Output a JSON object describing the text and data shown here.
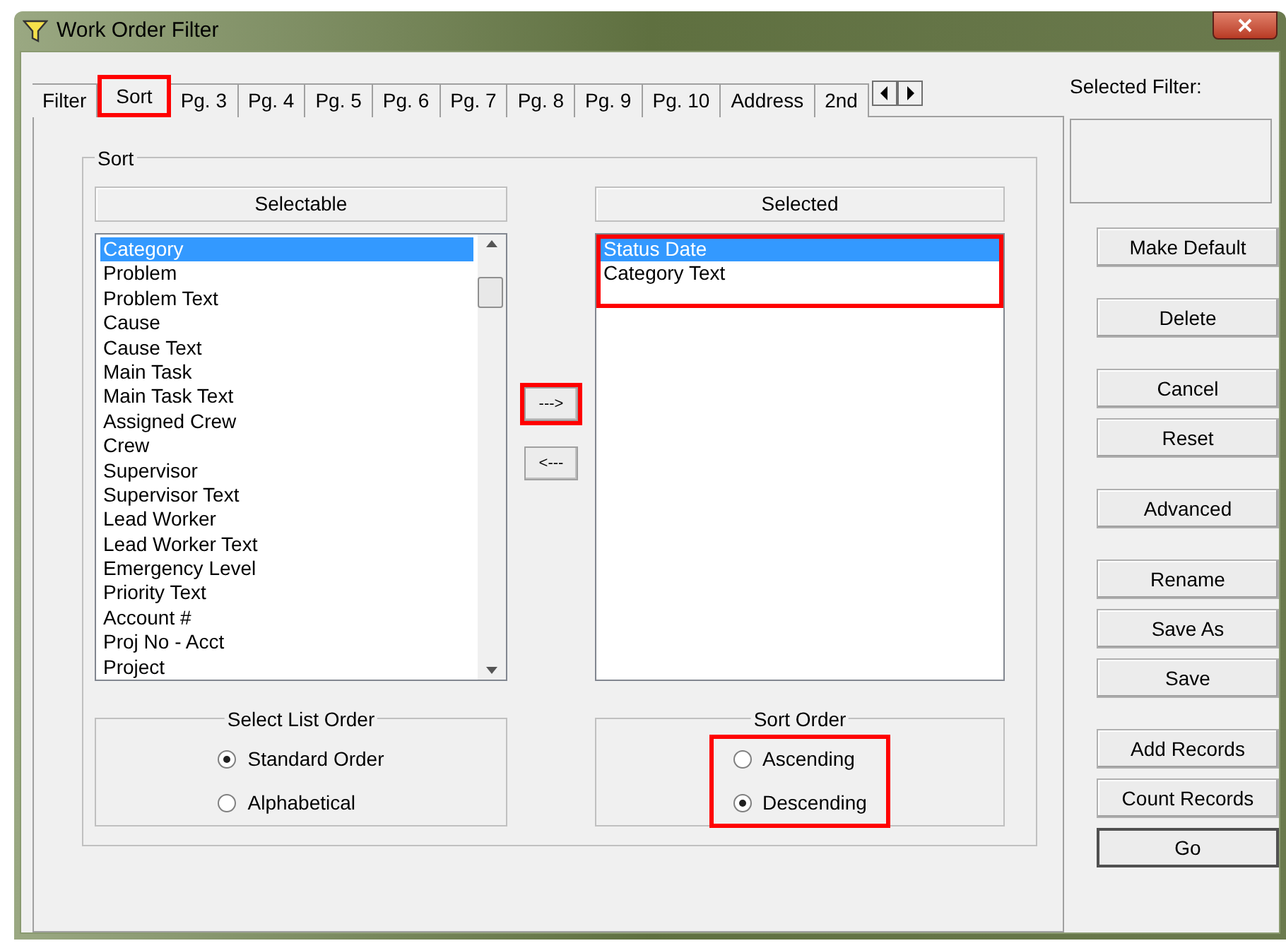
{
  "window": {
    "title": "Work Order Filter"
  },
  "tabs": [
    {
      "label": "Filter",
      "selected": false,
      "annotated": false
    },
    {
      "label": "Sort",
      "selected": true,
      "annotated": true
    },
    {
      "label": "Pg. 3",
      "selected": false,
      "annotated": false
    },
    {
      "label": "Pg. 4",
      "selected": false,
      "annotated": false
    },
    {
      "label": "Pg. 5",
      "selected": false,
      "annotated": false
    },
    {
      "label": "Pg. 6",
      "selected": false,
      "annotated": false
    },
    {
      "label": "Pg. 7",
      "selected": false,
      "annotated": false
    },
    {
      "label": "Pg. 8",
      "selected": false,
      "annotated": false
    },
    {
      "label": "Pg. 9",
      "selected": false,
      "annotated": false
    },
    {
      "label": "Pg. 10",
      "selected": false,
      "annotated": false
    },
    {
      "label": "Address",
      "selected": false,
      "annotated": false
    },
    {
      "label": "2nd",
      "selected": false,
      "annotated": false
    }
  ],
  "sort_group": {
    "title": "Sort",
    "selectable": {
      "header": "Selectable",
      "items": [
        {
          "label": "Category",
          "selected": true
        },
        {
          "label": "Problem",
          "selected": false
        },
        {
          "label": "Problem Text",
          "selected": false
        },
        {
          "label": "Cause",
          "selected": false
        },
        {
          "label": "Cause Text",
          "selected": false
        },
        {
          "label": "Main Task",
          "selected": false
        },
        {
          "label": "Main Task Text",
          "selected": false
        },
        {
          "label": "Assigned Crew",
          "selected": false
        },
        {
          "label": "Crew",
          "selected": false
        },
        {
          "label": "Supervisor",
          "selected": false
        },
        {
          "label": "Supervisor Text",
          "selected": false
        },
        {
          "label": "Lead Worker",
          "selected": false
        },
        {
          "label": "Lead Worker Text",
          "selected": false
        },
        {
          "label": "Emergency Level",
          "selected": false
        },
        {
          "label": "Priority Text",
          "selected": false
        },
        {
          "label": "Account #",
          "selected": false
        },
        {
          "label": "Proj No - Acct",
          "selected": false
        },
        {
          "label": "Project",
          "selected": false
        }
      ]
    },
    "move_buttons": [
      {
        "label": "--->",
        "annotated": true
      },
      {
        "label": "<---",
        "annotated": false
      }
    ],
    "selected": {
      "header": "Selected",
      "annotated": true,
      "items": [
        {
          "label": "Status Date",
          "selected": true
        },
        {
          "label": "Category Text",
          "selected": false
        }
      ]
    },
    "select_list_order": {
      "title": "Select List Order",
      "annotated": false,
      "options": [
        {
          "label": "Standard Order",
          "selected": true
        },
        {
          "label": "Alphabetical",
          "selected": false
        }
      ]
    },
    "sort_order": {
      "title": "Sort Order",
      "annotated": true,
      "options": [
        {
          "label": "Ascending",
          "selected": false
        },
        {
          "label": "Descending",
          "selected": true
        }
      ]
    }
  },
  "selected_filter": {
    "label": "Selected Filter:"
  },
  "button_groups": [
    [
      {
        "label": "Make Default",
        "default": false
      }
    ],
    [
      {
        "label": "Delete",
        "default": false
      }
    ],
    [
      {
        "label": "Cancel",
        "default": false
      },
      {
        "label": "Reset",
        "default": false
      }
    ],
    [
      {
        "label": "Advanced",
        "default": false
      }
    ],
    [
      {
        "label": "Rename",
        "default": false
      },
      {
        "label": "Save As",
        "default": false
      },
      {
        "label": "Save",
        "default": false
      }
    ],
    [
      {
        "label": "Add Records",
        "default": false
      },
      {
        "label": "Count Records",
        "default": false
      },
      {
        "label": "Go",
        "default": true
      }
    ]
  ]
}
